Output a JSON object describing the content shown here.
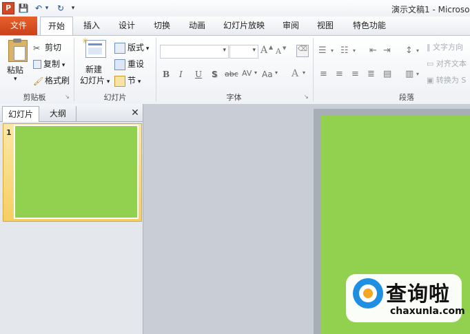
{
  "window": {
    "title": "演示文稿1 - Microso",
    "app_icon": "P"
  },
  "qat": {
    "save_icon": "💾",
    "undo_icon": "↶",
    "redo_icon": "↻",
    "more_icon": "▾"
  },
  "tabs": [
    {
      "label": "文件"
    },
    {
      "label": "开始"
    },
    {
      "label": "插入"
    },
    {
      "label": "设计"
    },
    {
      "label": "切换"
    },
    {
      "label": "动画"
    },
    {
      "label": "幻灯片放映"
    },
    {
      "label": "审阅"
    },
    {
      "label": "视图"
    },
    {
      "label": "特色功能"
    }
  ],
  "ribbon": {
    "clipboard": {
      "label": "剪贴板",
      "paste": "粘贴",
      "cut": "剪切",
      "copy": "复制",
      "format_painter": "格式刷"
    },
    "slides": {
      "label": "幻灯片",
      "new_slide_1": "新建",
      "new_slide_2": "幻灯片",
      "layout": "版式",
      "reset": "重设",
      "section": "节"
    },
    "font": {
      "label": "字体",
      "bold": "B",
      "italic": "I",
      "underline": "U",
      "shadow": "S",
      "strike": "abc",
      "spacing": "AV",
      "case": "Aa",
      "grow": "A",
      "shrink": "A",
      "color": "A"
    },
    "paragraph": {
      "label": "段落",
      "text_direction": "文字方向",
      "align_text": "对齐文本",
      "convert": "转换为 S"
    }
  },
  "left_pane": {
    "tab_slides": "幻灯片",
    "tab_outline": "大纲",
    "close": "✕",
    "slide_number": "1"
  },
  "colors": {
    "slide_green": "#92d050",
    "file_tab": "#d24726",
    "selection": "#f6cf62"
  },
  "watermark": {
    "text": "查询啦",
    "url": "chaxunla.com"
  }
}
